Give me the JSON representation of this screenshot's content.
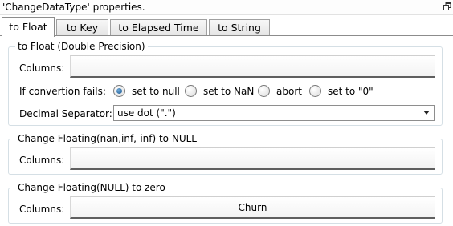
{
  "window": {
    "title": "'ChangeDataType' properties."
  },
  "tabs": [
    {
      "label": "to Float"
    },
    {
      "label": "to Key"
    },
    {
      "label": "to Elapsed Time"
    },
    {
      "label": "to String"
    }
  ],
  "to_float": {
    "title": "to Float (Double Precision)",
    "columns_label": "Columns:",
    "columns_value": "",
    "if_fails_label": "If convertion fails:",
    "options": [
      "set to null",
      "set to NaN",
      "abort",
      "set to \"0\""
    ],
    "selected_option": "set to null",
    "decimal_label": "Decimal Separator:",
    "decimal_value": "use dot (\".\")"
  },
  "nan_to_null": {
    "title": "Change  Floating(nan,inf,-inf)  to  NULL",
    "columns_label": "Columns:",
    "columns_value": ""
  },
  "null_to_zero": {
    "title": "Change Floating(NULL) to zero",
    "columns_label": "Columns:",
    "columns_value": "Churn"
  },
  "icons": {
    "restore": "restore-window-icon",
    "dropdown": "chevron-down-icon",
    "radio": "radio-button-icon"
  }
}
